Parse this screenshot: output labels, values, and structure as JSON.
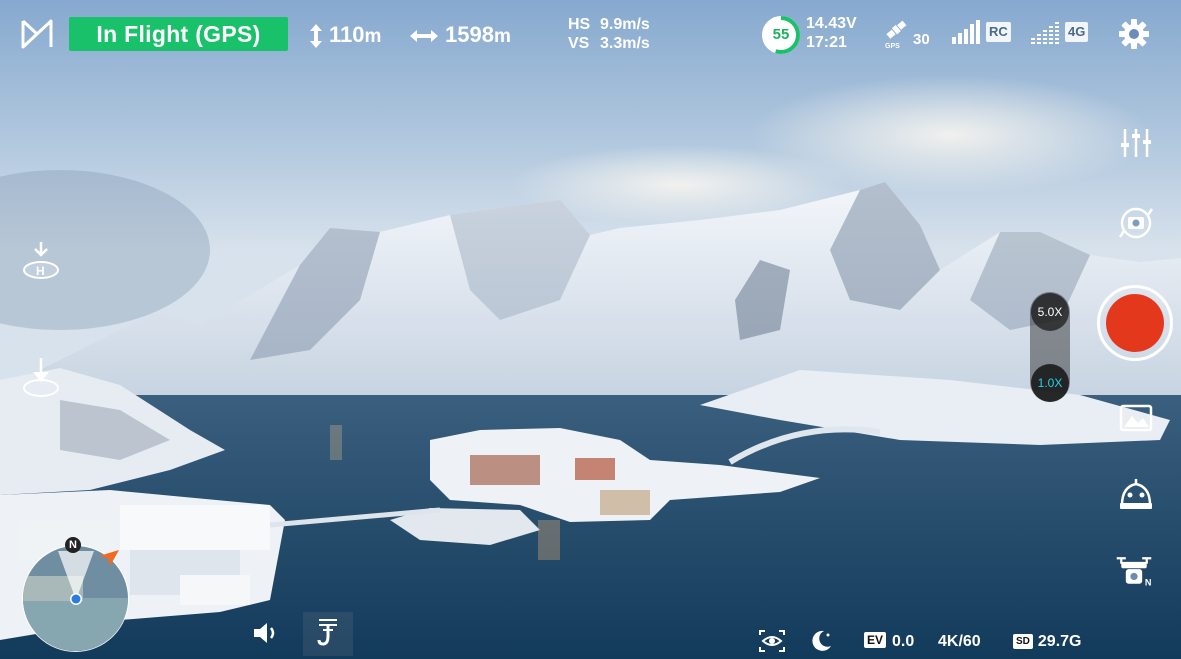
{
  "status": {
    "flight_mode": "In Flight (GPS)",
    "altitude_value": "110",
    "altitude_unit": "m",
    "distance_value": "1598",
    "distance_unit": "m"
  },
  "speeds": {
    "hs_label": "HS",
    "hs_value": "9.9m/s",
    "vs_label": "VS",
    "vs_value": "3.3m/s"
  },
  "power": {
    "battery_percent": "55",
    "battery_level": 0.55,
    "voltage": "14.43V",
    "flight_time": "17:21"
  },
  "signals": {
    "gps_label": "GPS",
    "gps_satellites": "30",
    "rc_label": "RC",
    "net_label": "4G"
  },
  "zoom": {
    "tele_label": "5.0X",
    "wide_label": "1.0X"
  },
  "minimap": {
    "north_label": "N"
  },
  "camera_status": {
    "ev_tag": "EV",
    "ev_value": "0.0",
    "resolution": "4K/60",
    "sd_tag": "SD",
    "storage": "29.7G"
  },
  "right_rail": {
    "drone_north_label": "N"
  },
  "icons": {
    "logo": "app-logo-icon",
    "altitude": "altitude-arrow-icon",
    "distance": "distance-arrow-icon",
    "satellite": "satellite-icon",
    "settings": "gear-icon",
    "return_home": "return-home-icon",
    "land": "land-icon",
    "sliders": "camera-settings-sliders-icon",
    "mode": "camera-mode-icon",
    "gallery": "gallery-icon",
    "gimbal": "gimbal-icon",
    "drone": "drone-camera-icon",
    "speaker": "speaker-icon",
    "hook": "payload-hook-icon",
    "vision": "vision-icon",
    "night": "night-mode-icon"
  },
  "colors": {
    "status_green": "#19c16a",
    "record_red": "#e4381d",
    "zoom_active": "#1fd3e6",
    "drone_marker": "#f26a21"
  }
}
